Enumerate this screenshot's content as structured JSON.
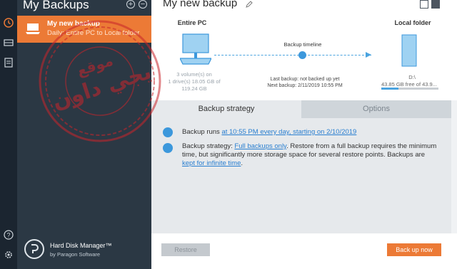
{
  "rail": {
    "icons": [
      "clock-icon",
      "drive-icon",
      "document-icon",
      "help-icon",
      "settings-icon"
    ]
  },
  "sidebar": {
    "title": "My Backups",
    "selected_backup": {
      "name": "My new backup",
      "schedule": "Daily: Entire PC to Local folder"
    },
    "product": {
      "name": "Hard Disk Manager™",
      "vendor": "by Paragon Software"
    }
  },
  "main": {
    "title": "My new backup",
    "source": {
      "title": "Entire PC",
      "info_line1": "3 volume(s) on",
      "info_line2": "1 drive(s) 18.05 GB of",
      "info_line3": "119.24 GB"
    },
    "timeline": {
      "label": "Backup timeline",
      "last_backup": "Last backup: not backed up yet",
      "next_backup": "Next backup: 2/11/2019 10:55 PM"
    },
    "destination": {
      "title": "Local folder",
      "path": "D:\\",
      "free": "43.85 GB free of 43.9...",
      "used_fraction": 0.3
    },
    "tabs": [
      "Backup strategy",
      "Options"
    ],
    "strategy": {
      "run_prefix": "Backup runs ",
      "run_link": "at 10:55 PM every day, starting on 2/10/2019",
      "strategy_prefix": "Backup strategy: ",
      "strategy_link": "Full backups only",
      "strategy_body": ". Restore from a full backup requires the minimum time, but significantly more storage space for several restore points. Backups are ",
      "keep_link": "kept for infinite time",
      "keep_suffix": "."
    },
    "buttons": {
      "restore": "Restore",
      "backup_now": "Back up now"
    }
  },
  "watermark": {
    "text_top": "موقع",
    "text_main": "يجي داون"
  },
  "colors": {
    "accent": "#ec7a36",
    "rail": "#1b2530",
    "sidebar": "#2b3844",
    "link": "#2a7fd0",
    "stamp": "#c9252b"
  }
}
